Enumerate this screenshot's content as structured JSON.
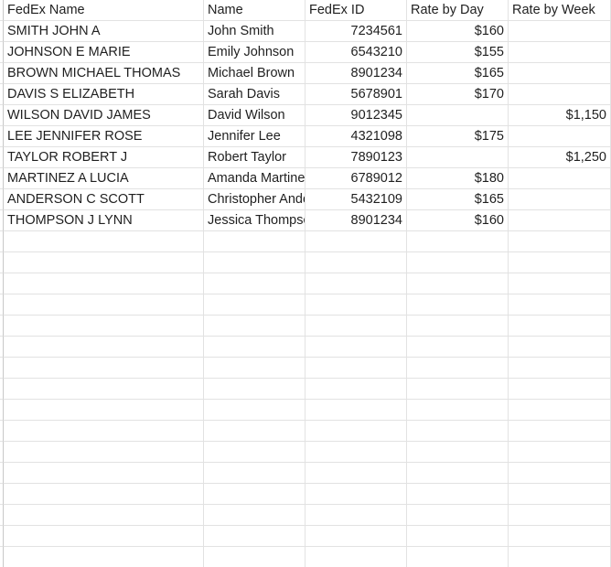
{
  "sheet": {
    "headers": [
      "FedEx Name",
      "Name",
      "FedEx ID",
      "Rate by Day",
      "Rate by Week"
    ],
    "rows": [
      [
        "SMITH JOHN A",
        "John Smith",
        "7234561",
        "$160",
        ""
      ],
      [
        "JOHNSON E MARIE",
        "Emily Johnson",
        "6543210",
        "$155",
        ""
      ],
      [
        "BROWN MICHAEL THOMAS",
        "Michael Brown",
        "8901234",
        "$165",
        ""
      ],
      [
        "DAVIS S ELIZABETH",
        "Sarah Davis",
        "5678901",
        "$170",
        ""
      ],
      [
        "WILSON DAVID JAMES",
        "David Wilson",
        "9012345",
        "",
        "$1,150"
      ],
      [
        "LEE JENNIFER ROSE",
        "Jennifer Lee",
        "4321098",
        "$175",
        ""
      ],
      [
        "TAYLOR ROBERT J",
        "Robert Taylor",
        "7890123",
        "",
        "$1,250"
      ],
      [
        "MARTINEZ A LUCIA",
        "Amanda Martinez",
        "6789012",
        "$180",
        ""
      ],
      [
        "ANDERSON C SCOTT",
        "Christopher Anderson",
        "5432109",
        "$165",
        ""
      ],
      [
        "THOMPSON J LYNN",
        "Jessica Thompson",
        "8901234",
        "$160",
        ""
      ]
    ],
    "empty_rows": 16
  }
}
